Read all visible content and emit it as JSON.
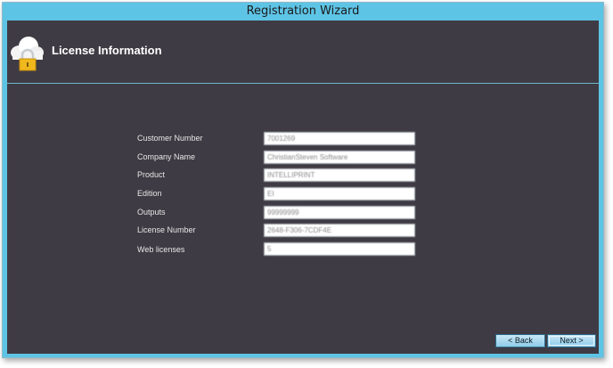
{
  "window": {
    "title": "Registration Wizard"
  },
  "header": {
    "title": "License Information",
    "icon": "cloud-lock-icon"
  },
  "colors": {
    "accent": "#5ec4e6",
    "panel": "#3f3b44"
  },
  "fields": [
    {
      "label": "Customer Number",
      "value": "7001269"
    },
    {
      "label": "Company Name",
      "value": "ChristianSteven Software"
    },
    {
      "label": "Product",
      "value": "INTELLIPRINT"
    },
    {
      "label": "Edition",
      "value": "EI"
    },
    {
      "label": "Outputs",
      "value": "99999999"
    },
    {
      "label": "License Number",
      "value": "2648-F306-7CDF4E"
    },
    {
      "label": "Web licenses",
      "value": "5"
    }
  ],
  "buttons": {
    "back": "< Back",
    "next": "Next >"
  }
}
